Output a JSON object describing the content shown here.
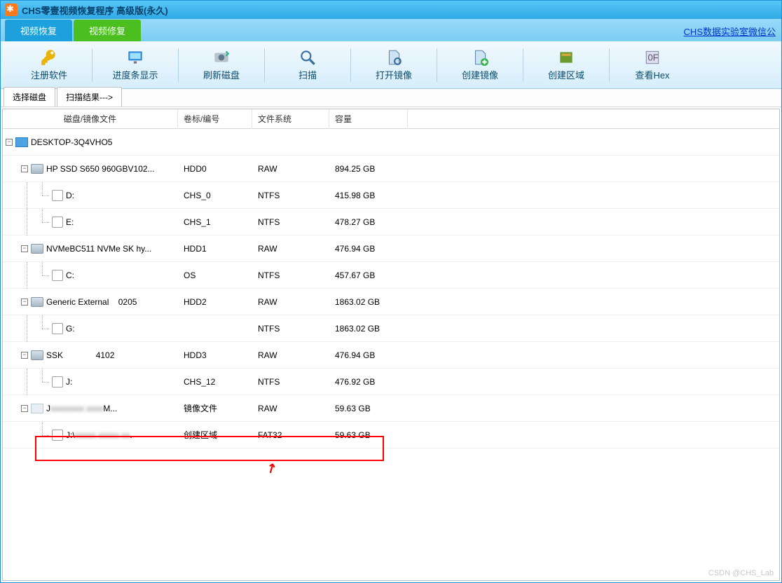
{
  "window": {
    "title": "CHS零壹视频恢复程序 高级版(永久)"
  },
  "subtabs": {
    "recover": "视频恢复",
    "repair": "视频修复"
  },
  "right_link": "CHS数据实验室微信公",
  "toolbar": {
    "register": "注册软件",
    "progress": "进度条显示",
    "refresh": "刷新磁盘",
    "scan": "扫描",
    "open_image": "打开镜像",
    "create_image": "创建镜像",
    "create_region": "创建区域",
    "view_hex": "查看Hex"
  },
  "tabs": {
    "select_disk": "选择磁盘",
    "scan_results": "扫描结果--->"
  },
  "columns": {
    "name": "磁盘/镜像文件",
    "label": "卷标/编号",
    "fs": "文件系统",
    "size": "容量"
  },
  "tree": {
    "root": "DESKTOP-3Q4VHO5",
    "d0": {
      "name": "HP SSD S650 960GBV102...",
      "label": "HDD0",
      "fs": "RAW",
      "size": "894.25 GB"
    },
    "d0p0": {
      "name": "D:",
      "label": "CHS_0",
      "fs": "NTFS",
      "size": "415.98 GB"
    },
    "d0p1": {
      "name": "E:",
      "label": "CHS_1",
      "fs": "NTFS",
      "size": "478.27 GB"
    },
    "d1": {
      "name": "NVMeBC511 NVMe SK hy...",
      "label": "HDD1",
      "fs": "RAW",
      "size": "476.94 GB"
    },
    "d1p0": {
      "name": "C:",
      "label": "OS",
      "fs": "NTFS",
      "size": "457.67 GB"
    },
    "d2": {
      "name": "Generic External",
      "extra": "0205",
      "label": "HDD2",
      "fs": "RAW",
      "size": "1863.02 GB"
    },
    "d2p0": {
      "name": "G:",
      "label": "",
      "fs": "NTFS",
      "size": "1863.02 GB"
    },
    "d3": {
      "name": "SSK",
      "extra": "4102",
      "label": "HDD3",
      "fs": "RAW",
      "size": "476.94 GB"
    },
    "d3p0": {
      "name": "J:",
      "label": "CHS_12",
      "fs": "NTFS",
      "size": "476.92 GB"
    },
    "d4": {
      "name": "J",
      "tail": "M...",
      "label": "镜像文件",
      "fs": "RAW",
      "size": "59.63 GB"
    },
    "d4p0": {
      "name": "J:\\",
      "tail": ".",
      "label": "创建区域",
      "fs": "FAT32",
      "size": "59.63 GB"
    }
  },
  "watermark": "CSDN @CHS_Lab"
}
